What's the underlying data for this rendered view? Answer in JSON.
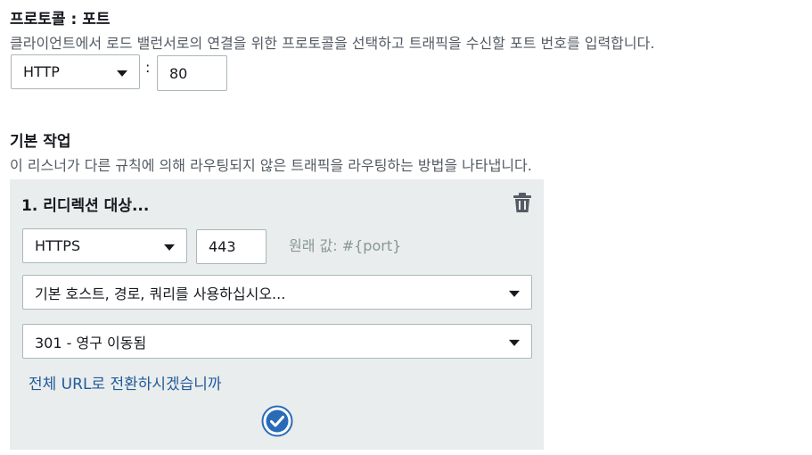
{
  "listener": {
    "title": "프로토콜 : 포트",
    "description": "클라이언트에서 로드 밸런서로의 연결을 위한 프로토콜을 선택하고 트래픽을 수신할 포트 번호를 입력합니다.",
    "protocol_value": "HTTP",
    "colon": ":",
    "port_value": "80"
  },
  "default_action": {
    "title": "기본 작업",
    "description": "이 리스너가 다른 규칙에 의해 라우팅되지 않은 트래픽을 라우팅하는 방법을 나타냅니다."
  },
  "redirect": {
    "title": "1. 리디렉션 대상...",
    "protocol_value": "HTTPS",
    "port_value": "443",
    "original_value_hint": "원래 값: #{port}",
    "host_path_query_value": "기본 호스트, 경로, 쿼리를 사용하십시오...",
    "status_code_value": "301 - 영구 이동됨",
    "switch_url_link": "전체 URL로 전환하시겠습니까"
  },
  "colors": {
    "link": "#1f5a9a",
    "accent": "#2a6bb8",
    "panel_bg": "#eaeded",
    "border": "#aab7b8"
  },
  "icons": {
    "delete": "trash-icon",
    "confirm": "checkmark-circle-icon",
    "dropdown": "caret-down-icon"
  }
}
